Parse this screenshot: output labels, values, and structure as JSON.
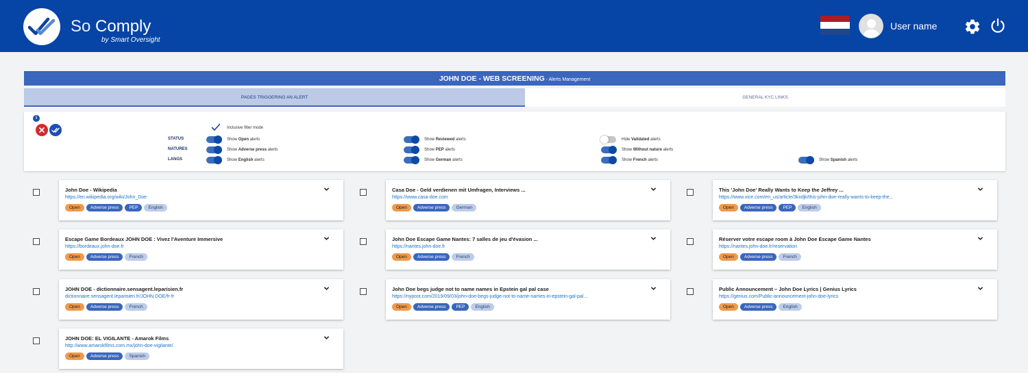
{
  "header": {
    "brand_prefix": "So",
    "brand_main": "Comply",
    "tagline": "by Smart Oversight",
    "user_name": "User name",
    "flag_colors": [
      "#ae1c28",
      "#ffffff",
      "#21468b"
    ]
  },
  "page": {
    "title_main": "JOHN DOE - WEB SCREENING",
    "title_sub": " - Alerts Management",
    "tabs": [
      {
        "label": "PAGES TRIGGERING AN ALERT",
        "active": true
      },
      {
        "label": "GENERAL KYC LINKS",
        "active": false
      }
    ]
  },
  "filters": {
    "info_icon": "i",
    "inclusive_mode_label": "Inclusive filter mode",
    "rows": [
      {
        "label": "STATUS",
        "items": [
          {
            "prefix": "Show ",
            "bold": "Open",
            "suffix": " alerts",
            "on": true
          },
          {
            "prefix": "Show ",
            "bold": "Reviewed",
            "suffix": " alerts",
            "on": true
          },
          {
            "prefix": "Hide ",
            "bold": "Validated",
            "suffix": " alerts",
            "on": false
          }
        ]
      },
      {
        "label": "NATURES",
        "items": [
          {
            "prefix": "Show ",
            "bold": "Adverse press",
            "suffix": " alerts",
            "on": true
          },
          {
            "prefix": "Show ",
            "bold": "PEP",
            "suffix": " alerts",
            "on": true
          },
          {
            "prefix": "Show ",
            "bold": "Without nature",
            "suffix": " alerts",
            "on": true
          }
        ]
      },
      {
        "label": "LANGS",
        "items": [
          {
            "prefix": "Show ",
            "bold": "English",
            "suffix": " alerts",
            "on": true
          },
          {
            "prefix": "Show ",
            "bold": "German",
            "suffix": " alerts",
            "on": true
          },
          {
            "prefix": "Show ",
            "bold": "French",
            "suffix": " alerts",
            "on": true
          },
          {
            "prefix": "Show ",
            "bold": "Spanish",
            "suffix": " alerts",
            "on": true
          }
        ]
      }
    ]
  },
  "cards": [
    {
      "title": "John Doe - Wikipedia",
      "url": "https://en.wikipedia.org/wiki/John_Doe",
      "badges": [
        "Open",
        "Adverse press",
        "PEP",
        "English"
      ]
    },
    {
      "title": "Casa Doe - Geld verdienen mit Umfragen, Interviews ...",
      "url": "https://www.casa-doe.com",
      "badges": [
        "Open",
        "Adverse press",
        "German"
      ]
    },
    {
      "title": "This 'John Doe' Really Wants to Keep the Jeffrey ...",
      "url": "https://www.vice.com/en_us/article/3kxdjk/this-john-doe-really-wants-to-keep-the...",
      "badges": [
        "Open",
        "Adverse press",
        "PEP",
        "English"
      ]
    },
    {
      "title": "Escape Game Bordeaux JOHN DOE : Vivez l'Aventure Immersive",
      "url": "https://bordeaux.john-doe.fr",
      "badges": [
        "Open",
        "Adverse press",
        "French"
      ]
    },
    {
      "title": "John Doe Escape Game Nantes: 7 salles de jeu d'évasion ...",
      "url": "https://nantes.john-doe.fr",
      "badges": [
        "Open",
        "Adverse press",
        "French"
      ]
    },
    {
      "title": "Réserver votre escape room à John Doe Escape Game Nantes",
      "url": "https://nantes.john-doe.fr/reservation",
      "badges": [
        "Open",
        "Adverse press",
        "French"
      ]
    },
    {
      "title": "JOHN DOE - dictionnaire.sensagent.leparisien.fr",
      "url": "dictionnaire.sensagent.leparisien.fr/JOHN DOE/fr-fr",
      "badges": [
        "Open",
        "Adverse press",
        "French"
      ]
    },
    {
      "title": "John Doe begs judge not to name names in Epstein gal pal case",
      "url": "https://nypost.com/2019/09/03/john-doe-begs-judge-not-to-name-names-in-epstein-gal-pal...",
      "badges": [
        "Open",
        "Adverse press",
        "PEP",
        "English"
      ]
    },
    {
      "title": "Public Announcement – John Doe Lyrics | Genius Lyrics",
      "url": "https://genius.com/Public-announcement-john-doe-lyrics",
      "badges": [
        "Open",
        "Adverse press",
        "English"
      ]
    },
    {
      "title": "JOHN DOE: EL VIGILANTE - Amarok Films",
      "url": "http://www.amarokfilms.com.mx/john-doe-vigilante/",
      "badges": [
        "Open",
        "Adverse press",
        "Spanish"
      ]
    }
  ]
}
